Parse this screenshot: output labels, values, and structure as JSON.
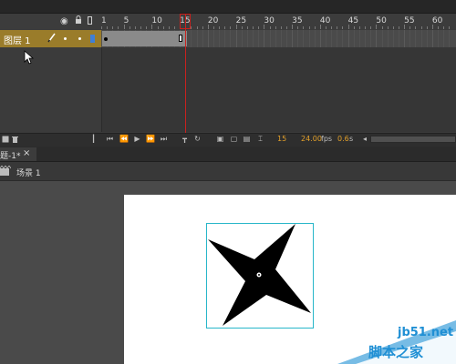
{
  "timeline": {
    "ruler_labels": [
      "1",
      "5",
      "10",
      "15",
      "20",
      "25",
      "30",
      "35",
      "40",
      "45",
      "50",
      "55",
      "60"
    ],
    "layer_name": "图层 1",
    "current_frame": "15",
    "fps": "24.00",
    "fps_unit": "fps",
    "elapsed": "0.6",
    "elapsed_unit": "s"
  },
  "document": {
    "tab_label": "题-1*",
    "tab_close": "×",
    "scene_label": "场景 1"
  },
  "watermark": {
    "site": "jb51.net",
    "brand": "脚本之家"
  },
  "colors": {
    "layer_highlight": "#9a7c2a",
    "playhead": "#c8221e",
    "selection_box": "#27b6c9",
    "fps_text": "#e3a02a"
  },
  "icons": [
    "eye-icon",
    "lock-icon",
    "outline-icon",
    "pencil-icon",
    "new-layer-icon",
    "delete-layer-icon",
    "first-frame-icon",
    "step-back-icon",
    "play-icon",
    "step-forward-icon",
    "last-frame-icon",
    "loop-icon",
    "onion-skin-icon",
    "scene-icon"
  ]
}
